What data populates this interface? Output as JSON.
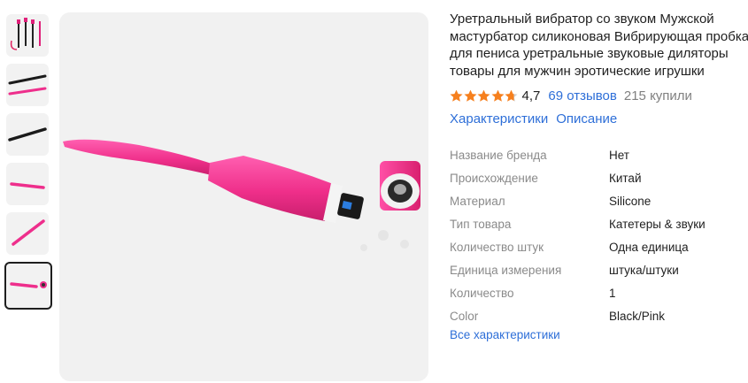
{
  "product": {
    "title_lines": [
      "Уретральный вибратор со звуком Мужской",
      "мастурбатор силиконовая Вибрирующая пробка",
      "для пениса уретральные звуковые диляторы",
      "товары для мужчин эротические игрушки"
    ],
    "rating": "4,7",
    "rating_value": 4.7,
    "reviews_link": "69 отзывов",
    "sold": "215 купили"
  },
  "tabs": [
    "Характеристики",
    "Описание"
  ],
  "specs": [
    {
      "key": "Название бренда",
      "value": "Нет"
    },
    {
      "key": "Происхождение",
      "value": "Китай"
    },
    {
      "key": "Материал",
      "value": "Silicone"
    },
    {
      "key": "Тип товара",
      "value": "Катетеры & звуки"
    },
    {
      "key": "Количество штук",
      "value": "Одна единица"
    },
    {
      "key": "Единица измерения",
      "value": "штука/штуки"
    },
    {
      "key": "Количество",
      "value": "1"
    },
    {
      "key": "Color",
      "value": "Black/Pink"
    }
  ],
  "all_specs_link": "Все характеристики",
  "thumbnails": [
    {
      "icon": "product-set-thumbnail"
    },
    {
      "icon": "black-pink-pair-thumbnail"
    },
    {
      "icon": "black-device-thumbnail"
    },
    {
      "icon": "pink-device-thumbnail"
    },
    {
      "icon": "pink-device-thumbnail"
    },
    {
      "icon": "pink-device-open-thumbnail",
      "selected": true
    }
  ],
  "colors": {
    "accent_link": "#2e6fd8",
    "star": "#f6801e",
    "product_pink": "#ef2f8a"
  }
}
